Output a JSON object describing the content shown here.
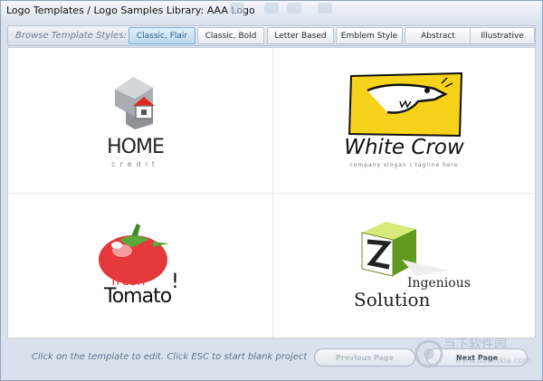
{
  "window": {
    "title": "Logo Templates / Logo Samples Library: AAA Logo"
  },
  "tabs": {
    "label": "Browse Template Styles:",
    "items": [
      {
        "label": "Classic, Flair",
        "active": true
      },
      {
        "label": "Classic, Bold",
        "active": false
      },
      {
        "label": "Letter Based",
        "active": false
      },
      {
        "label": "Emblem Style",
        "active": false
      },
      {
        "label": "Abstract",
        "active": false
      },
      {
        "label": "Illustrative",
        "active": false
      }
    ]
  },
  "templates": {
    "home": {
      "title": "HOME",
      "subtitle": "credit",
      "icon": "house-icon"
    },
    "crow": {
      "title": "White Crow",
      "subtitle": "company slogan \\ tagline here",
      "icon": "crow-icon"
    },
    "tomato": {
      "small": "fresh",
      "title": "Tomato",
      "icon": "tomato-icon"
    },
    "solution": {
      "small": "Ingenious",
      "title": "Solution",
      "icon": "z-cube-icon"
    }
  },
  "footer": {
    "hint": "Click on the template to edit. Click ESC to start blank project",
    "prev_label": "Previous Page",
    "next_label": "Next Page"
  },
  "watermark": {
    "text": "当下软件园",
    "url": "www.downxia.com"
  },
  "colors": {
    "accent": "#2c5f8e",
    "tomato_red": "#e4383a",
    "crow_yellow": "#f7d21b"
  }
}
